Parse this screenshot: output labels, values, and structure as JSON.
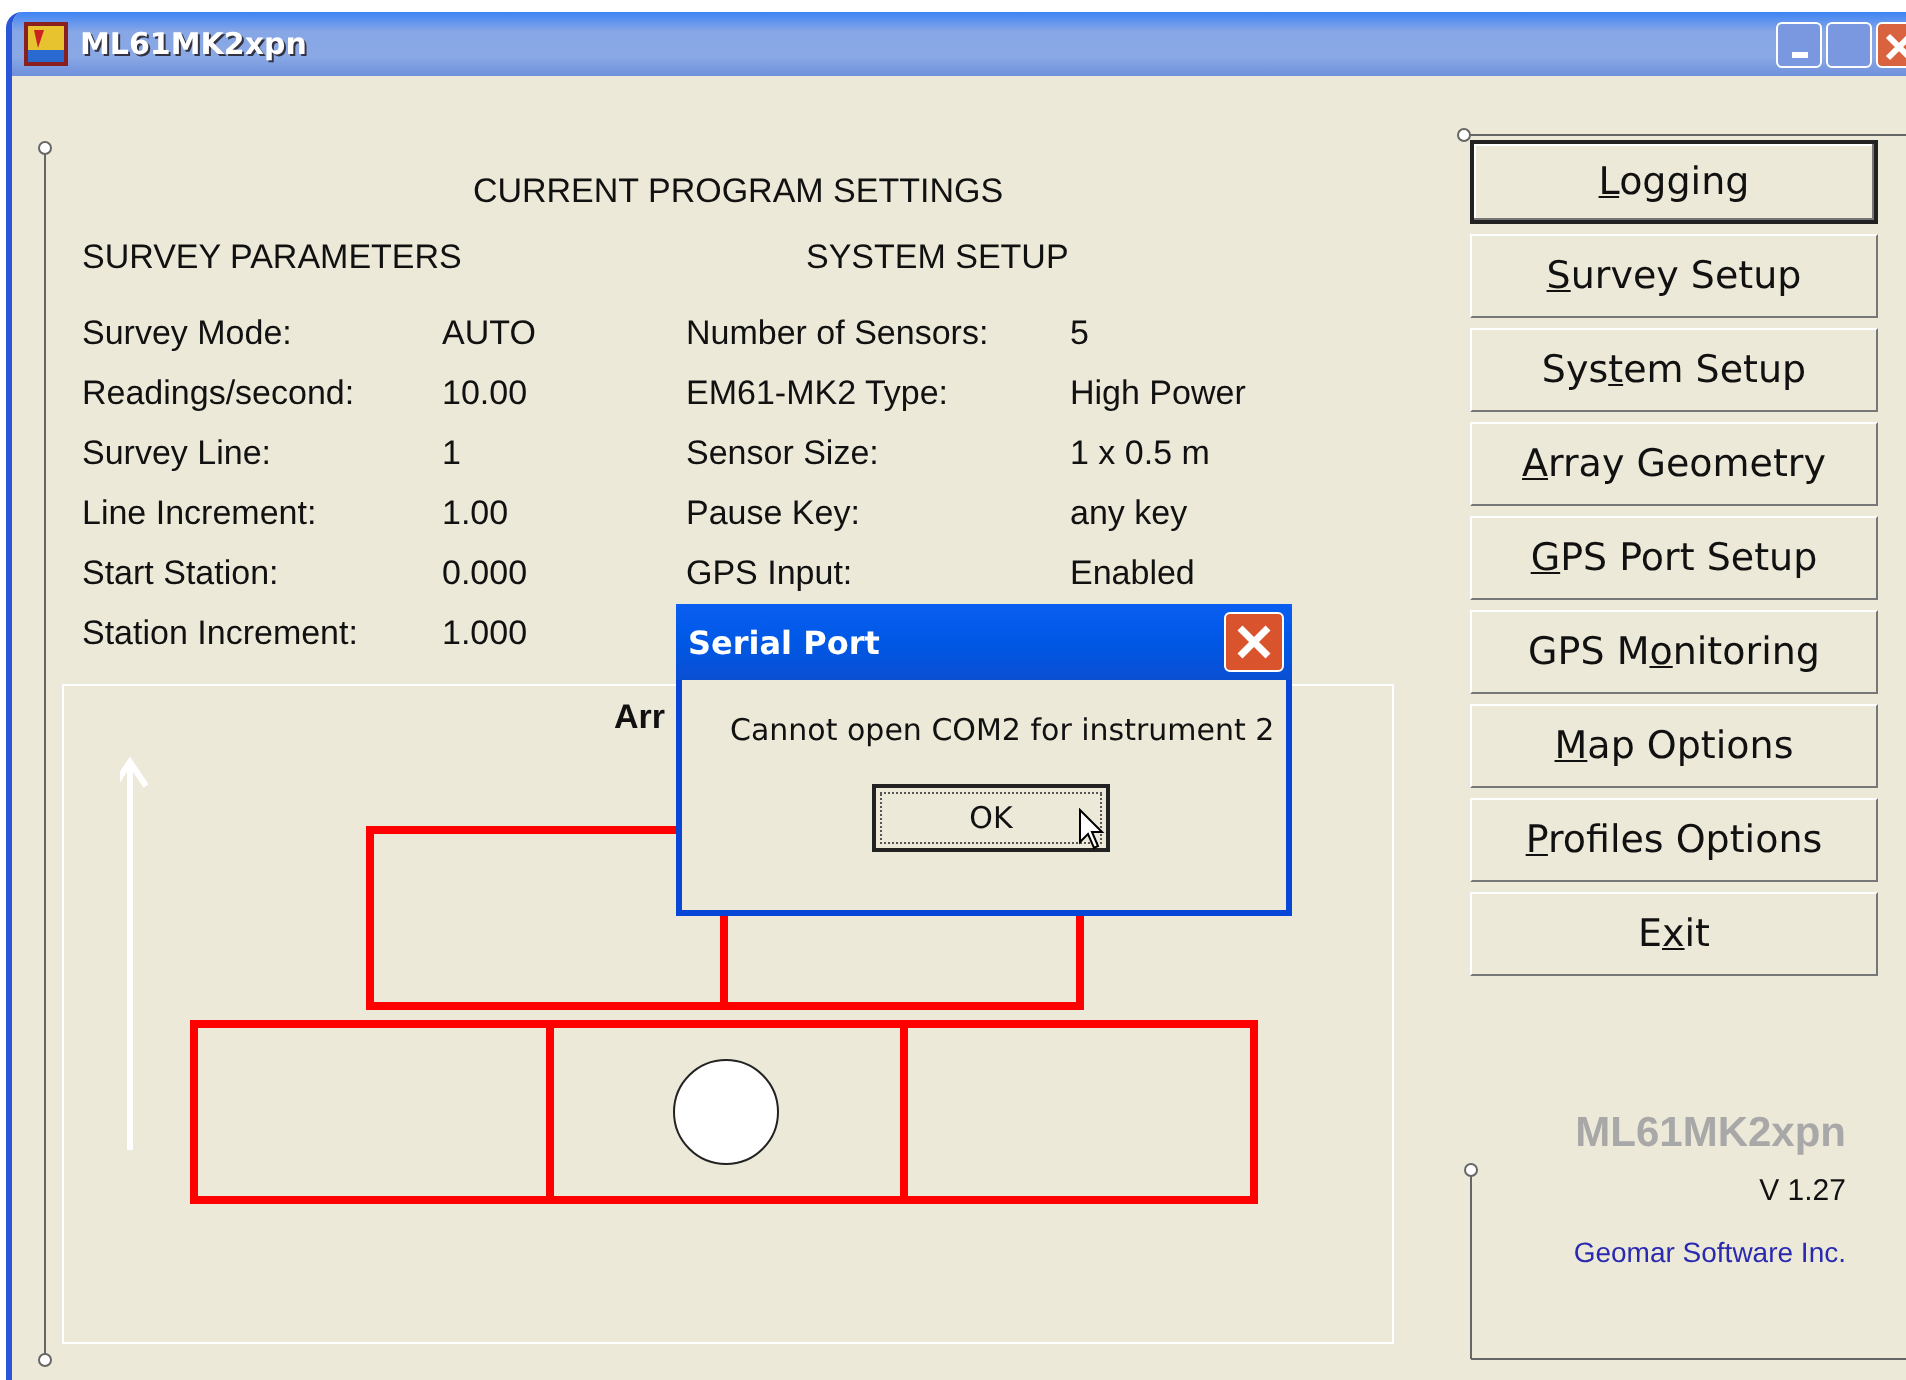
{
  "window": {
    "title": "ML61MK2xpn"
  },
  "settings": {
    "title": "CURRENT PROGRAM SETTINGS",
    "survey_parameters": {
      "heading": "SURVEY PARAMETERS",
      "rows": [
        {
          "label": "Survey Mode:",
          "value": "AUTO"
        },
        {
          "label": "Readings/second:",
          "value": "10.00"
        },
        {
          "label": "Survey Line:",
          "value": "1"
        },
        {
          "label": "Line Increment:",
          "value": "1.00"
        },
        {
          "label": "Start Station:",
          "value": "0.000"
        },
        {
          "label": "Station Increment:",
          "value": "1.000"
        }
      ]
    },
    "system_setup": {
      "heading": "SYSTEM SETUP",
      "rows": [
        {
          "label": "Number of Sensors:",
          "value": "5"
        },
        {
          "label": "EM61-MK2 Type:",
          "value": "High Power"
        },
        {
          "label": "Sensor Size:",
          "value": "1 x 0.5 m"
        },
        {
          "label": "Pause Key:",
          "value": "any key"
        },
        {
          "label": "GPS Input:",
          "value": "Enabled"
        }
      ]
    }
  },
  "array_panel": {
    "title": "Arr"
  },
  "buttons": [
    {
      "underlined": "L",
      "after": "ogging",
      "selected": true
    },
    {
      "underlined": "S",
      "after": "urvey Setup",
      "selected": false
    },
    {
      "before": "Sys",
      "underlined": "t",
      "after": "em Setup",
      "selected": false
    },
    {
      "underlined": "A",
      "after": "rray Geometry",
      "selected": false
    },
    {
      "underlined": "G",
      "after": "PS Port Setup",
      "selected": false
    },
    {
      "before": "GPS M",
      "underlined": "o",
      "after": "nitoring",
      "selected": false
    },
    {
      "underlined": "M",
      "after": "ap Options",
      "selected": false
    },
    {
      "underlined": "P",
      "after": "rofiles Options",
      "selected": false
    },
    {
      "before": "E",
      "underlined": "x",
      "after": "it",
      "selected": false
    }
  ],
  "about": {
    "name": "ML61MK2xpn",
    "version": "V 1.27",
    "company": "Geomar Software Inc."
  },
  "dialog": {
    "title": "Serial Port",
    "message": "Cannot open COM2 for instrument 2",
    "button": "OK"
  }
}
